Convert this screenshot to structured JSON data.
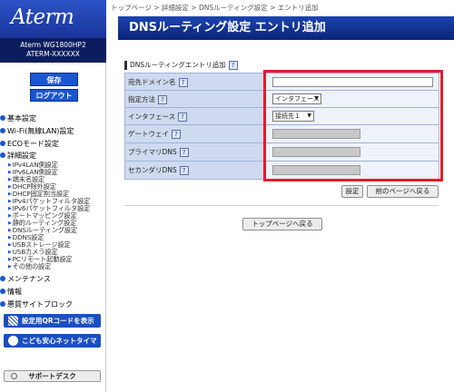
{
  "sidebar": {
    "logo": "Aterm",
    "model": "Aterm WG1800HP2",
    "device": "ATERM-XXXXXX",
    "save_label": "保存",
    "logout_label": "ログアウト",
    "categories": {
      "basic": "基本設定",
      "wifi": "Wi-Fi(無線LAN)設定",
      "eco": "ECOモード設定",
      "detail": "詳細設定",
      "maint": "メンテナンス",
      "info": "情報",
      "block": "悪質サイトブロック"
    },
    "detail_items": [
      "IPv4LAN側設定",
      "IPv6LAN側設定",
      "端末名設定",
      "DHCP除外設定",
      "DHCP固定割当設定",
      "IPv4パケットフィルタ設定",
      "IPv6パケットフィルタ設定",
      "ポートマッピング設定",
      "静的ルーティング設定",
      "DNSルーティング設定",
      "DDNS設定",
      "USBストレージ設定",
      "USBカメラ設定",
      "PCリモート起動設定",
      "その他の設定"
    ],
    "qr_label": "設定用QRコードを表示",
    "kids_label": "こども安心ネットタイマー",
    "support_label": "サポートデスク"
  },
  "breadcrumb": {
    "top": "トップページ",
    "detail": "詳細設定",
    "dns": "DNSルーティング設定",
    "current": "エントリ追加",
    "sep": " > "
  },
  "page_title": "DNSルーティング設定 エントリ追加",
  "section_title": "DNSルーティングエントリ追加",
  "help_glyph": "?",
  "form": {
    "domain_label": "宛先ドメイン名",
    "domain_value": "",
    "method_label": "指定方法",
    "method_value": "インタフェース",
    "iface_label": "インタフェース",
    "iface_value": "接続先１",
    "gateway_label": "ゲートウェイ",
    "dns1_label": "プライマリDNS",
    "dns2_label": "セカンダリDNS"
  },
  "buttons": {
    "set": "設定",
    "back": "前のページへ戻る",
    "top": "トップページへ戻る"
  },
  "colors": {
    "accent": "#1a56d0",
    "title_bar": "#0f2f8e",
    "highlight": "#e8192c"
  }
}
